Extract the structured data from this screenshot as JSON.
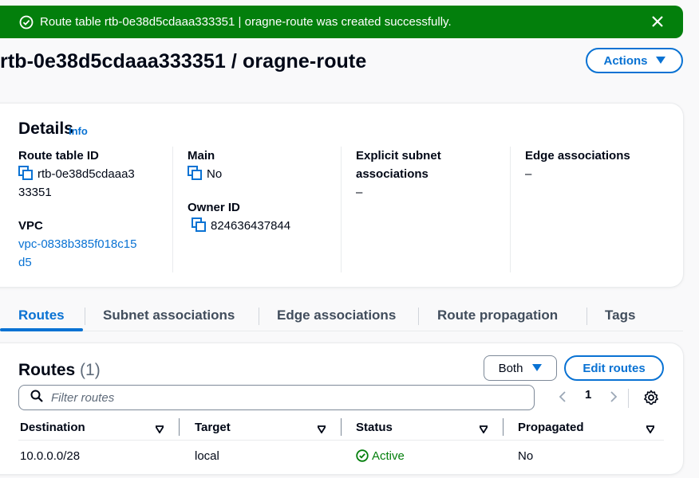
{
  "flash": {
    "message": "Route table rtb-0e38d5cdaaa333351 | oragne-route was created successfully.",
    "status_color": "#037f0c"
  },
  "header": {
    "title": "rtb-0e38d5cdaaa333351 / oragne-route",
    "actions_label": "Actions"
  },
  "details": {
    "heading": "Details",
    "info_label": "Info",
    "route_table_id_label": "Route table ID",
    "route_table_id_line1": "rtb-0e38d5cdaaa3",
    "route_table_id_line2": "33351",
    "vpc_label": "VPC",
    "vpc_line1": "vpc-0838b385f018c15",
    "vpc_line2": "d5",
    "main_label": "Main",
    "main_value": "No",
    "owner_id_label": "Owner ID",
    "owner_id_value": "824636437844",
    "explicit_label_line1": "Explicit subnet",
    "explicit_label_line2": "associations",
    "explicit_value": "–",
    "edge_label": "Edge associations",
    "edge_value": "–"
  },
  "tabs": [
    {
      "label": "Routes",
      "active": true
    },
    {
      "label": "Subnet associations",
      "active": false
    },
    {
      "label": "Edge associations",
      "active": false
    },
    {
      "label": "Route propagation",
      "active": false
    },
    {
      "label": "Tags",
      "active": false
    }
  ],
  "routes": {
    "heading": "Routes",
    "count": "(1)",
    "filter_select": "Both",
    "edit_label": "Edit routes",
    "filter_placeholder": "Filter routes",
    "page_number": "1",
    "columns": [
      "Destination",
      "Target",
      "Status",
      "Propagated"
    ],
    "rows": [
      {
        "destination": "10.0.0.0/28",
        "target": "local",
        "status": "Active",
        "propagated": "No"
      }
    ]
  },
  "colors": {
    "accent": "#0972d3",
    "success": "#037f0c",
    "text": "#000716"
  }
}
